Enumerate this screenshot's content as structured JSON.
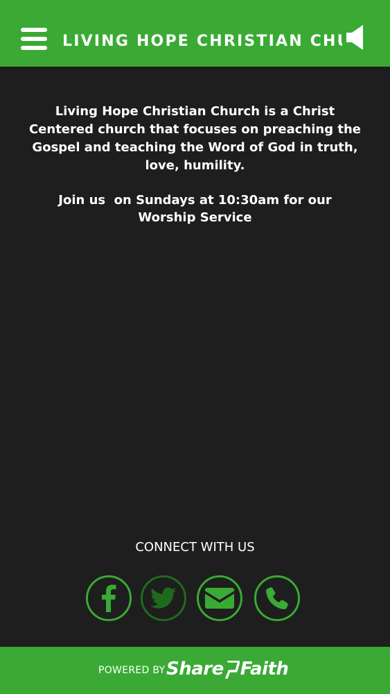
{
  "header": {
    "title": "LIVING HOPE CHRISTIAN CHURCH",
    "menu_icon": "hamburger-menu-icon",
    "speaker_icon": "speaker-icon"
  },
  "main": {
    "intro": "Living Hope Christian Church is a Christ Centered church that focuses on preaching the Gospel and teaching the Word of God in truth, love, humility.",
    "service": "Join us  on Sundays at 10:30am for our Worship Service"
  },
  "connect": {
    "title": "CONNECT WITH US",
    "icons": [
      "facebook-icon",
      "twitter-icon",
      "email-icon",
      "phone-icon"
    ]
  },
  "footer": {
    "powered_by": "POWERED BY",
    "brand_part1": "Share",
    "brand_part2": "Faith"
  },
  "colors": {
    "accent": "#3aaa35",
    "accent_dim": "#1f6b1c",
    "background": "#1e1e1e",
    "text": "#ffffff"
  }
}
